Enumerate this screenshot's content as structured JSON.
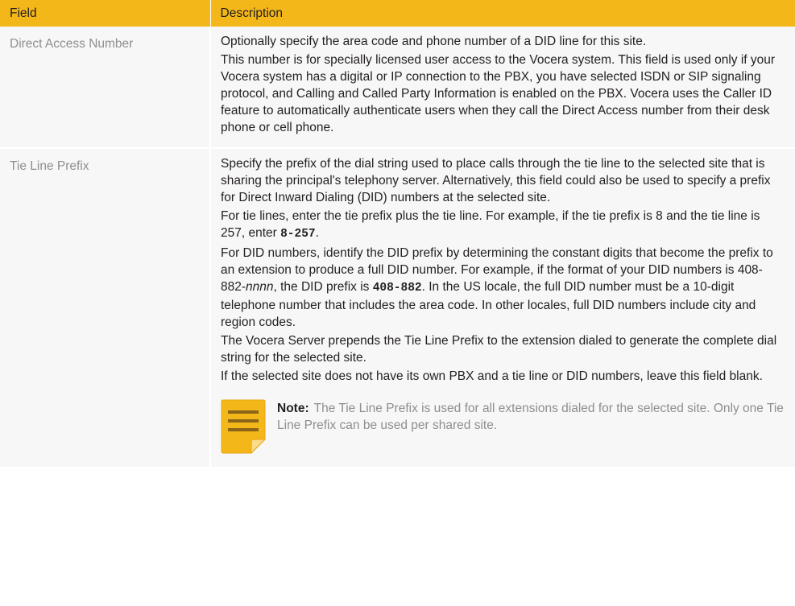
{
  "header": {
    "field": "Field",
    "description": "Description"
  },
  "rows": [
    {
      "field": "Direct Access Number",
      "paragraphs": [
        "Optionally specify the area code and phone number of a DID line for this site.",
        "This number is for specially licensed user access to the Vocera system. This field is used only if your Vocera system has a digital or IP connection to the PBX, you have selected ISDN or SIP signaling protocol, and Calling and Called Party Information is enabled on the PBX. Vocera uses the Caller ID feature to automatically authenticate users when they call the Direct Access number from their desk phone or cell phone."
      ]
    },
    {
      "field": "Tie Line Prefix",
      "p1": "Specify the prefix of the dial string used to place calls through the tie line to the selected site that is sharing the principal's telephony server. Alternatively, this field could also be used to specify a prefix for Direct Inward Dialing (DID) numbers at the selected site.",
      "p2_before": "For tie lines, enter the tie prefix plus the tie line. For example, if the tie prefix is 8 and the tie line is 257, enter ",
      "p2_code": "8-257",
      "p2_after": ".",
      "p3_a": "For DID numbers, identify the DID prefix by determining the constant digits that become the prefix to an extension to produce a full DID number. For example, if the format of your DID numbers is 408-882-",
      "p3_italic": "nnnn",
      "p3_b": ", the DID prefix is ",
      "p3_code": "408-882",
      "p3_c": ". In the US locale, the full DID number must be a 10-digit telephone number that includes the area code. In other locales, full DID numbers include city and region codes.",
      "p4": "The Vocera Server prepends the Tie Line Prefix to the extension dialed to generate the complete dial string for the selected site.",
      "p5": "If the selected site does not have its own PBX and a tie line or DID numbers, leave this field blank.",
      "note": {
        "icon": "note-icon",
        "label": "Note:",
        "text": "The Tie Line Prefix is used for all extensions dialed for the selected site. Only one Tie Line Prefix can be used per shared site."
      }
    }
  ],
  "colors": {
    "header_bg": "#f4b71a",
    "row_bg": "#f7f7f7",
    "field_text": "#8e8e8e",
    "body_text": "#231f20",
    "note_icon": "#f4b71a"
  }
}
